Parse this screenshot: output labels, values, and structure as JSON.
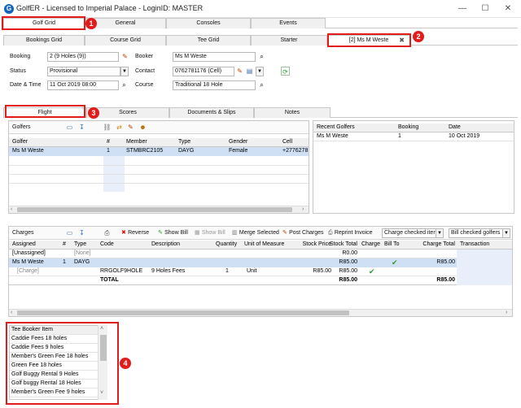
{
  "window": {
    "title": "GolfER - Licensed to Imperial Palace - LoginID: MASTER",
    "minimize": "—",
    "maximize": "☐",
    "close": "✕"
  },
  "main_tabs": [
    "Golf Grid",
    "General",
    "Consoles",
    "Events"
  ],
  "sub_tabs": [
    "Bookings Grid",
    "Course Grid",
    "Tee Grid",
    "Starter",
    "[2] Ms M Weste"
  ],
  "booking_form": {
    "booking_label": "Booking",
    "booking_value": "2 (9 Holes (9))",
    "status_label": "Status",
    "status_value": "Provisional",
    "datetime_label": "Date & Time",
    "datetime_value": "11 Oct 2019 08:00",
    "booker_label": "Booker",
    "booker_value": "Ms M Weste",
    "contact_label": "Contact",
    "contact_value": "0762781176 (Cell)",
    "course_label": "Course",
    "course_value": "Traditional 18 Hole"
  },
  "detail_tabs": [
    "Flight",
    "Scores",
    "Documents & Slips",
    "Notes"
  ],
  "golfers": {
    "title": "Golfers",
    "columns": [
      "Golfer",
      "#",
      "Member",
      "Type",
      "Gender",
      "Cell"
    ],
    "rows": [
      [
        "Ms M Weste",
        "1",
        "STMBRC2105",
        "DAYG",
        "Female",
        "+2776278"
      ]
    ]
  },
  "recent": {
    "columns": [
      "Recent Golfers",
      "Booking",
      "Date"
    ],
    "rows": [
      [
        "Ms M Weste",
        "1",
        "10 Oct 2019"
      ]
    ]
  },
  "charges": {
    "title": "Charges",
    "toolbar": {
      "reverse": "Reverse",
      "show_bill": "Show Bill",
      "show_bill2": "Show Bill",
      "merge": "Merge Selected",
      "post": "Post Charges",
      "reprint": "Reprint Invoice",
      "dd1": "Charge checked iter",
      "dd2": "Bill checked golfers"
    },
    "columns": [
      "Assigned",
      "#",
      "Type",
      "Code",
      "Description",
      "Quantity",
      "Unit of Measure",
      "Stock Price",
      "Stock Total",
      "Charge",
      "Bill To",
      "Charge Total",
      "Transaction"
    ],
    "rows": [
      {
        "assigned": "[Unassigned]",
        "num": "",
        "type": "[None]",
        "code": "",
        "desc": "",
        "qty": "",
        "uom": "",
        "price": "",
        "total": "R0.00",
        "charge": "",
        "billto": "",
        "ctotal": ""
      },
      {
        "assigned": "Ms M Weste",
        "num": "1",
        "type": "DAYG",
        "code": "",
        "desc": "",
        "qty": "",
        "uom": "",
        "price": "",
        "total": "R85.00",
        "charge": "",
        "billto": "✔",
        "ctotal": "R85.00"
      },
      {
        "assigned": "[Charge]",
        "num": "",
        "type": "",
        "code": "RRGOLF9HOLE",
        "desc": "9 Holes Fees",
        "qty": "1",
        "uom": "Unit",
        "price": "R85.00",
        "total": "R85.00",
        "charge": "✔",
        "billto": "",
        "ctotal": ""
      },
      {
        "assigned": "",
        "num": "",
        "type": "",
        "code": "TOTAL",
        "desc": "",
        "qty": "",
        "uom": "",
        "price": "",
        "total": "R85.00",
        "charge": "",
        "billto": "",
        "ctotal": "R85.00"
      }
    ]
  },
  "tee_booker": {
    "header": "Tee Booker Item",
    "items": [
      "Caddie Fees 18 holes",
      "Caddie Fees 9 holes",
      "Member's Green Fee 18 holes",
      "Green Fee 18 holes",
      "Golf Buggy Rental 9 Holes",
      "Golf buggy Rental 18 Holes",
      "Member's Green Fee 9 holes"
    ]
  },
  "annotations": [
    "1",
    "2",
    "3",
    "4"
  ],
  "colors": {
    "accent_red": "#e21b1b",
    "selection": "#cfe0f5",
    "check_green": "#2e9b2e"
  }
}
